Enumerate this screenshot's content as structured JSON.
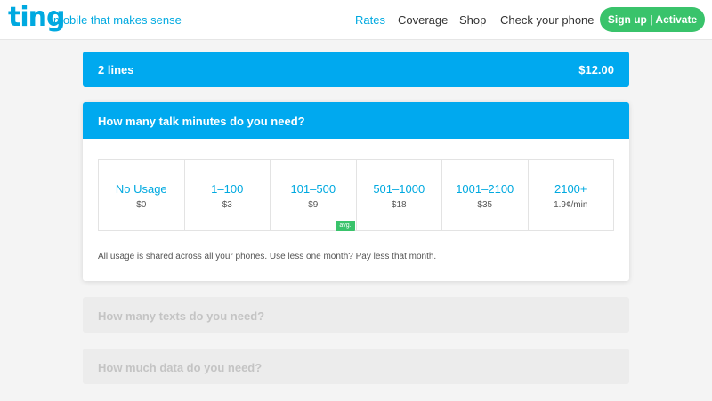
{
  "header": {
    "logo": "ting",
    "tagline": "mobile that makes sense",
    "nav": {
      "rates": "Rates",
      "coverage": "Coverage",
      "shop": "Shop",
      "check": "Check your phone"
    },
    "signup": "Sign up | Activate"
  },
  "lines": {
    "label": "2 lines",
    "price": "$12.00"
  },
  "talk": {
    "question": "How many talk minutes do you need?",
    "options": [
      {
        "label": "No Usage",
        "price": "$0"
      },
      {
        "label": "1–100",
        "price": "$3"
      },
      {
        "label": "101–500",
        "price": "$9",
        "badge": "avg."
      },
      {
        "label": "501–1000",
        "price": "$18"
      },
      {
        "label": "1001–2100",
        "price": "$35"
      },
      {
        "label": "2100+",
        "price": "1.9¢/min"
      }
    ],
    "note": "All usage is shared across all your phones. Use less one month? Pay less that month."
  },
  "texts": {
    "question": "How many texts do you need?"
  },
  "data": {
    "question": "How much data do you need?"
  },
  "colors": {
    "brand": "#00a9e0",
    "bar": "#00a9ef",
    "green": "#39c36b"
  }
}
